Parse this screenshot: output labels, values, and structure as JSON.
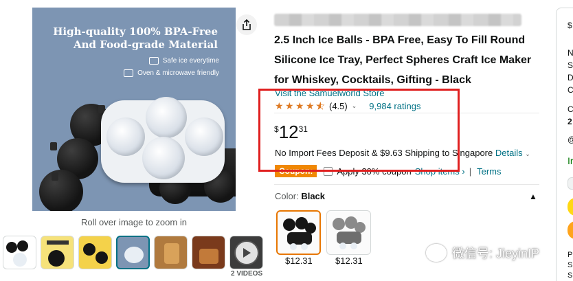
{
  "hero": {
    "headline_line1": "High-quality 100% BPA-Free",
    "headline_line2": "And Food-grade Material",
    "feature1": "Safe ice everytime",
    "feature2": "Oven & microwave friendly"
  },
  "zoom_hint": "Roll over image to zoom in",
  "videos_label": "2 VIDEOS",
  "product": {
    "title": "2.5 Inch Ice Balls - BPA Free, Easy To Fill Round Silicone Ice Tray, Perfect Spheres Craft Ice Maker for Whiskey, Cocktails, Gifting - Black",
    "store_link": "Visit the Samuelworld Store",
    "rating_value": "(4.5)",
    "rating_stars": 4.5,
    "ratings_count": "9,984 ratings",
    "price_symbol": "$",
    "price_whole": "12",
    "price_fraction": "31",
    "shipping_text": "No Import Fees Deposit & $9.63 Shipping to Singapore",
    "details_link": "Details",
    "coupon_badge": "Coupon:",
    "coupon_text": "Apply 30% coupon",
    "shop_items_link": "Shop items ›",
    "divider": "|",
    "terms_link": "Terms",
    "color_label": "Color:",
    "color_value": "Black",
    "swatches": [
      {
        "price": "$12.31"
      },
      {
        "price": "$12.31"
      }
    ]
  },
  "buybox": {
    "chars": [
      "$",
      "N",
      "S",
      "D",
      "C",
      "C",
      "2",
      "@",
      "Ir",
      "P",
      "S",
      "S"
    ]
  },
  "watermark": "微信号: JieyinIP",
  "colors": {
    "link": "#007185",
    "coupon": "#f08804",
    "highlight": "#e02020",
    "star": "#de7921",
    "hero_bg": "#7d95b3"
  }
}
